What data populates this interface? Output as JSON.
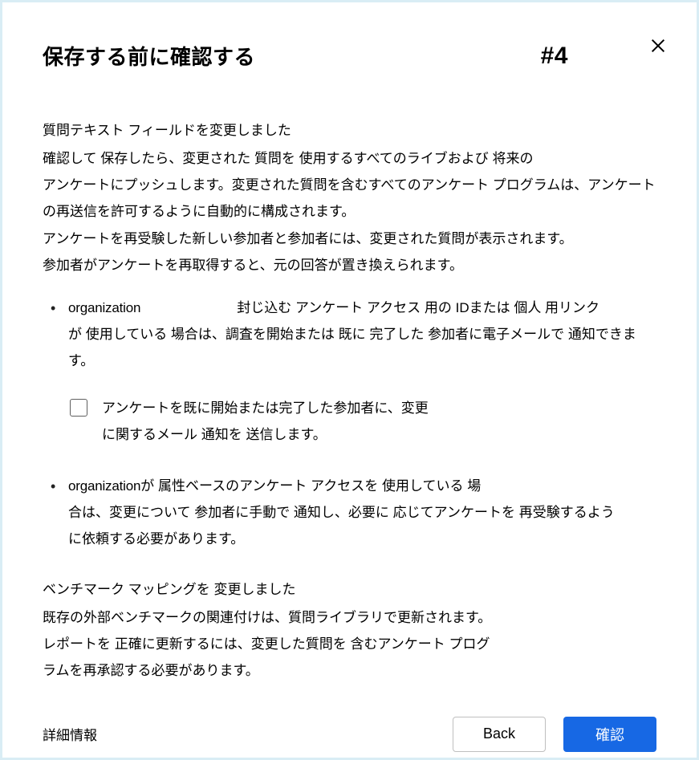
{
  "header": {
    "title": "保存する前に確認する",
    "tag": "#4"
  },
  "section1": {
    "heading": "質問テキスト フィールドを変更しました",
    "p1": "確認して 保存したら、変更された 質問を 使用するすべてのライブおよび 将来の",
    "p2": "アンケートにプッシュします。変更された質問を含むすべてのアンケート プログラムは、アンケートの再送信を許可するように自動的に構成されます。",
    "p3": "アンケートを再受験した新しい参加者と参加者には、変更された質問が表示されます。",
    "p4": "参加者がアンケートを再取得すると、元の回答が置き換えられます。"
  },
  "bullets": {
    "b1_org": "organization",
    "b1_inline": "封じ込む アンケート アクセス 用の IDまたは 個人 用リンク",
    "b1_rest": "が 使用している 場合は、調査を開始または 既に 完了した 参加者に電子メールで 通知できます。",
    "checkbox_label_l1": "アンケートを既に開始または完了した参加者に、変更",
    "checkbox_label_l2": "に関するメール 通知を 送信します。",
    "b2_org": "organization",
    "b2_line1_rest": "が 属性ベースのアンケート アクセスを 使用している 場",
    "b2_line2": "合は、変更について 参加者に手動で 通知し、必要に 応じてアンケートを 再受験するよう",
    "b2_line3": "に依頼する必要があります。"
  },
  "section2": {
    "heading": "ベンチマーク マッピングを 変更しました",
    "p1": "既存の外部ベンチマークの関連付けは、質問ライブラリで更新されます。",
    "p2": "レポートを 正確に更新するには、変更した質問を 含むアンケート プログ",
    "p3": "ラムを再承認する必要があります。"
  },
  "footer": {
    "more": "詳細情報",
    "back": "Back",
    "confirm": "確認"
  }
}
